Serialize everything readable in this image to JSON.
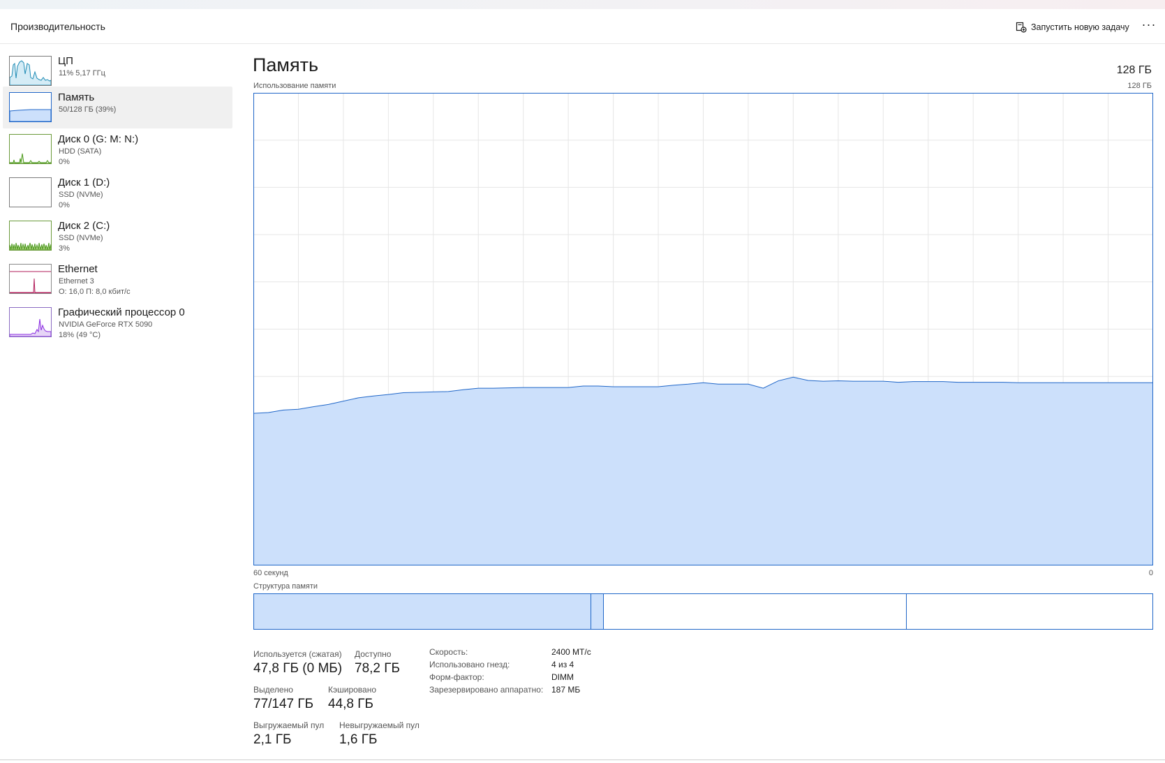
{
  "header": {
    "title": "Производительность",
    "run_task_label": "Запустить новую задачу",
    "more_label": "···"
  },
  "sidebar": {
    "items": [
      {
        "name": "ЦП",
        "sub": "11% 5,17 ГГц",
        "sub2": "",
        "color": "#1e8bb4"
      },
      {
        "name": "Память",
        "sub": "50/128 ГБ (39%)",
        "sub2": "",
        "color": "#1f66c8"
      },
      {
        "name": "Диск 0 (G: M: N:)",
        "sub": "HDD (SATA)",
        "sub2": "0%",
        "color": "#4d9a1e"
      },
      {
        "name": "Диск 1 (D:)",
        "sub": "SSD (NVMe)",
        "sub2": "0%",
        "color": "#4d9a1e"
      },
      {
        "name": "Диск 2 (C:)",
        "sub": "SSD (NVMe)",
        "sub2": "3%",
        "color": "#4d9a1e"
      },
      {
        "name": "Ethernet",
        "sub": "Ethernet 3",
        "sub2": "О: 16,0 П: 8,0 кбит/с",
        "color": "#b3215d"
      },
      {
        "name": "Графический процессор 0",
        "sub": "NVIDIA GeForce RTX 5090",
        "sub2": "18% (49 °C)",
        "color": "#8a2be2"
      }
    ]
  },
  "main": {
    "title": "Память",
    "total": "128 ГБ",
    "usage_label": "Использование памяти",
    "usage_max": "128 ГБ",
    "axis_left": "60 секунд",
    "axis_right": "0",
    "structure_label": "Структура памяти"
  },
  "stats": {
    "in_use_label": "Используется (сжатая)",
    "in_use_value": "47,8 ГБ (0 МБ)",
    "available_label": "Доступно",
    "available_value": "78,2 ГБ",
    "committed_label": "Выделено",
    "committed_value": "77/147 ГБ",
    "cached_label": "Кэшировано",
    "cached_value": "44,8 ГБ",
    "paged_label": "Выгружаемый пул",
    "paged_value": "2,1 ГБ",
    "nonpaged_label": "Невыгружаемый пул",
    "nonpaged_value": "1,6 ГБ"
  },
  "details": [
    {
      "label": "Скорость:",
      "value": "2400 МТ/с"
    },
    {
      "label": "Использовано гнезд:",
      "value": "4 из 4"
    },
    {
      "label": "Форм-фактор:",
      "value": "DIMM"
    },
    {
      "label": "Зарезервировано аппаратно:",
      "value": "187 МБ"
    }
  ],
  "chart_data": {
    "type": "area",
    "xlim": [
      60,
      0
    ],
    "ylim": [
      0,
      128
    ],
    "grid": true,
    "color": "#1f66c8",
    "fill": "#cce0fb",
    "x": [
      60,
      59,
      58,
      57,
      56,
      55,
      54,
      53,
      52,
      51,
      50,
      49,
      48,
      47,
      46,
      45,
      44,
      43,
      42,
      41,
      40,
      39,
      38,
      37,
      36,
      35,
      34,
      33,
      32,
      31,
      30,
      29,
      28,
      27,
      26,
      25,
      24,
      23,
      22,
      21,
      20,
      19,
      18,
      17,
      16,
      15,
      14,
      13,
      12,
      11,
      10,
      9,
      8,
      7,
      6,
      5,
      4,
      3,
      2,
      1,
      0
    ],
    "values": [
      41.2,
      41.4,
      42.1,
      42.3,
      43.0,
      43.6,
      44.5,
      45.4,
      45.9,
      46.3,
      46.8,
      46.9,
      47.0,
      47.1,
      47.6,
      48.0,
      48.0,
      48.1,
      48.2,
      48.2,
      48.2,
      48.2,
      48.6,
      48.6,
      48.4,
      48.4,
      48.4,
      48.4,
      48.8,
      49.1,
      49.5,
      49.1,
      49.1,
      49.1,
      48.0,
      50.0,
      51.0,
      50.1,
      49.9,
      50.0,
      49.9,
      49.9,
      49.9,
      49.6,
      49.8,
      49.8,
      49.8,
      49.6,
      49.6,
      49.6,
      49.6,
      49.5,
      49.5,
      49.5,
      49.5,
      49.5,
      49.5,
      49.5,
      49.5,
      49.5,
      49.5
    ]
  },
  "structure": {
    "in_use_fraction": 0.375,
    "modified_fraction": 0.014,
    "standby_fraction": 0.337,
    "free_fraction": 0.274
  }
}
